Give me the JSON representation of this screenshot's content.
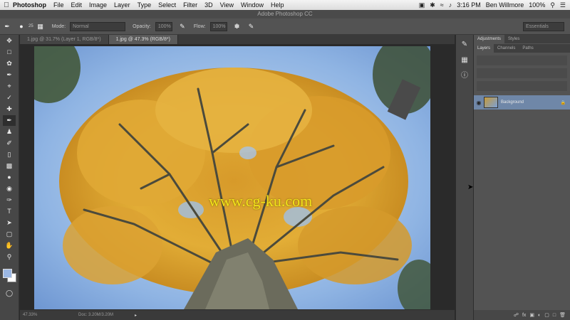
{
  "menubar": {
    "app": "Photoshop",
    "items": [
      "File",
      "Edit",
      "Image",
      "Layer",
      "Type",
      "Select",
      "Filter",
      "3D",
      "View",
      "Window",
      "Help"
    ],
    "time": "3:16 PM",
    "user": "Ben Willmore",
    "battery": "100%"
  },
  "window": {
    "title": "Adobe Photoshop CC"
  },
  "options": {
    "brush_size": "25",
    "mode_label": "Mode:",
    "mode_value": "Normal",
    "opacity_label": "Opacity:",
    "opacity_value": "100%",
    "flow_label": "Flow:",
    "flow_value": "100%",
    "workspace": "Essentials"
  },
  "tabs": [
    {
      "label": "1.jpg @ 31.7% (Layer 1, RGB/8*)"
    },
    {
      "label": "1.jpg @ 47.3% (RGB/8*)"
    }
  ],
  "watermark": "www.cg-ku.com",
  "status": {
    "zoom": "47.33%",
    "doc": "Doc: 3.20M/3.20M"
  },
  "panel": {
    "tabs_top": [
      "Adjustments",
      "Styles"
    ],
    "tabs": [
      "Layers",
      "Channels",
      "Paths"
    ],
    "layer_name": "Background"
  },
  "colors": {
    "fg": "#9bb7e3",
    "bg": "#ffffff",
    "selection": "#6f87a8"
  }
}
